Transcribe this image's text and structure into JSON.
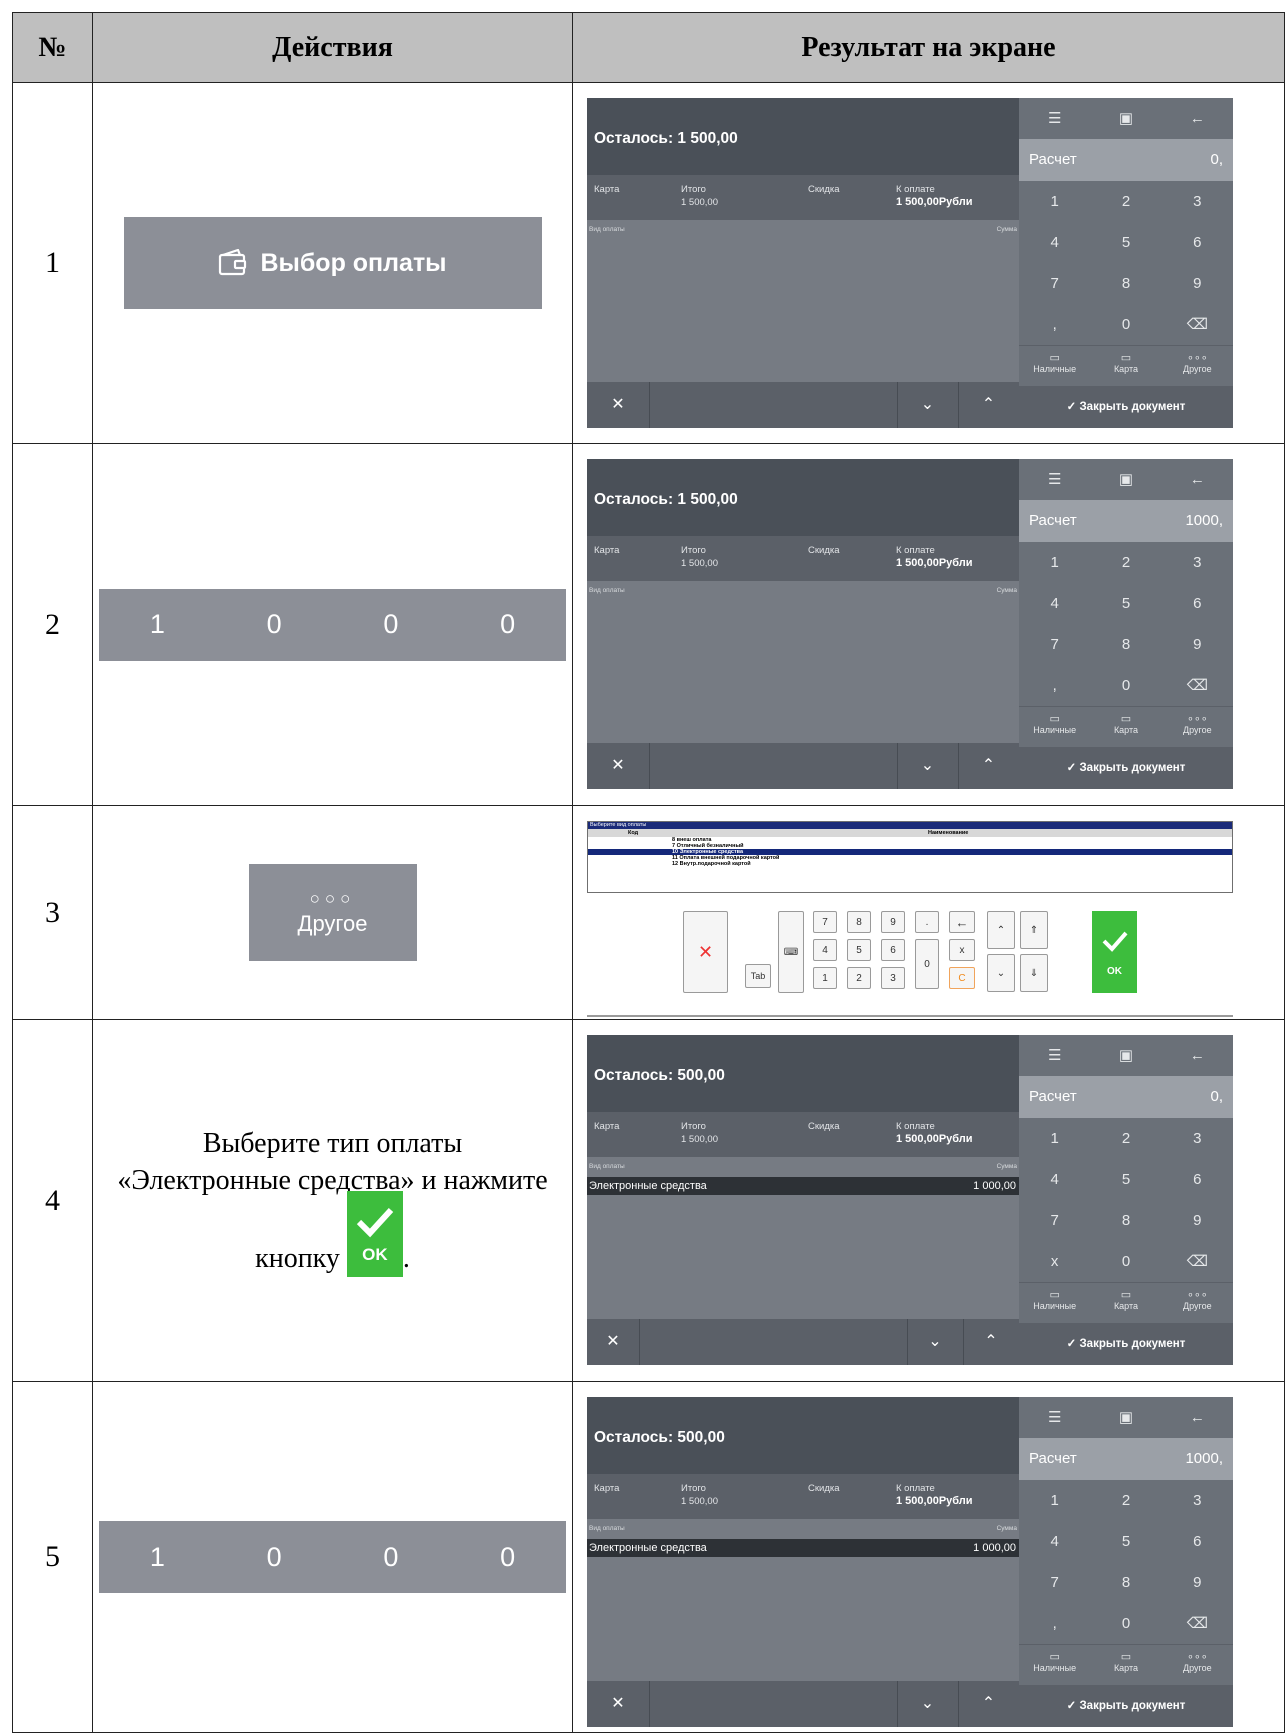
{
  "header": {
    "num": "№",
    "actions": "Действия",
    "result": "Результат на экране"
  },
  "rows": [
    {
      "num": "1",
      "action": "Выбор оплаты"
    },
    {
      "num": "2",
      "digits": [
        "1",
        "0",
        "0",
        "0"
      ]
    },
    {
      "num": "3",
      "dots": "○○○",
      "label": "Другое"
    },
    {
      "num": "4",
      "text1": "Выберите тип оплаты",
      "text2": "«Электронные средства» и нажмите",
      "text3": "кнопку",
      "ok": "OK",
      "tail": "."
    },
    {
      "num": "5",
      "digits": [
        "1",
        "0",
        "0",
        "0"
      ]
    }
  ],
  "pos": {
    "card": "Карта",
    "total_label": "Итого",
    "total": "1 500,00",
    "discount": "Скидка",
    "topay_label": "К оплате",
    "topay": "1 500,00Рубли",
    "type_col": "Вид оплаты",
    "sum_col": "Сумма",
    "calc": "Расчет",
    "keys": [
      "1",
      "2",
      "3",
      "4",
      "5",
      "6",
      "7",
      "8",
      "9"
    ],
    "comma": ",",
    "zero": "0",
    "x": "x",
    "cash": "Наличные",
    "card_btn": "Карта",
    "other": "Другое",
    "close": "Закрыть документ",
    "pay_line": "Электронные средства",
    "pay_amount": "1 000,00",
    "screens": [
      {
        "left": "Осталось: 1 500,00",
        "calc_val": "0,"
      },
      {
        "left": "Осталось: 1 500,00",
        "calc_val": "1000,"
      },
      {
        "left": "Осталось: 500,00",
        "calc_val": "0,"
      },
      {
        "left": "Осталось: 500,00",
        "calc_val": "1000,"
      }
    ]
  },
  "selector": {
    "title": "Выберите вид оплаты",
    "col_code": "Код",
    "col_name": "Наименование",
    "items": [
      "8 внеш оплата",
      "7 Отличный безналичный",
      "10 Электронные средства",
      "11 Оплата внешней подарочной картой",
      "12 Внутр.подарочной картой"
    ],
    "selected_index": 2,
    "keypad": [
      "7",
      "8",
      "9",
      ".",
      "4",
      "5",
      "6",
      "0",
      "x",
      "1",
      "2",
      "3",
      "C"
    ],
    "tab": "Tab",
    "ok": "OK"
  }
}
